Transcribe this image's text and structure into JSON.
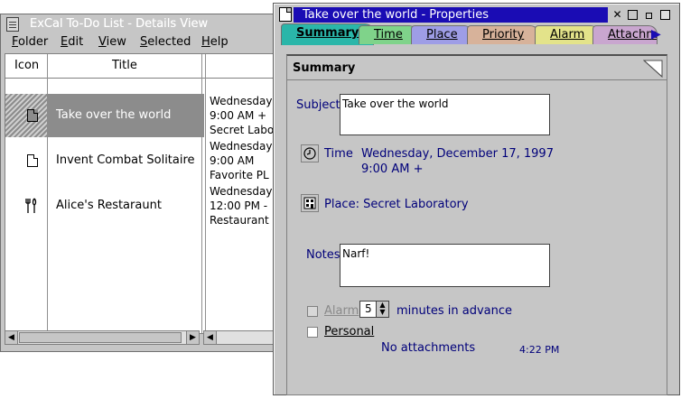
{
  "back_window": {
    "title": "ExCal To-Do List - Details View",
    "menu": [
      "Folder",
      "Edit",
      "View",
      "Selected",
      "Help"
    ],
    "columns": {
      "icon": "Icon",
      "title": "Title"
    },
    "rows": [
      {
        "title": "Take over the world",
        "icon": "document-icon",
        "details": [
          "Wednesday,",
          "9:00 AM +",
          "Secret Labo"
        ]
      },
      {
        "title": "Invent Combat Solitaire",
        "icon": "document-icon",
        "details": [
          "Wednesday,",
          "9:00 AM",
          "Favorite PL"
        ]
      },
      {
        "title": "Alice's Restaraunt",
        "icon": "fork-knife-icon",
        "details": [
          "Wednesday,",
          "12:00 PM -",
          "Restaurant"
        ]
      }
    ]
  },
  "front_window": {
    "title": "Take over the world - Properties",
    "tabs": [
      {
        "label": "Summary",
        "color": "#2ab6a9"
      },
      {
        "label": "Time",
        "color": "#7fd38a"
      },
      {
        "label": "Place",
        "color": "#9e9de6"
      },
      {
        "label": "Priority",
        "color": "#d7b29a"
      },
      {
        "label": "Alarm",
        "color": "#e3e38a"
      },
      {
        "label": "Attachm",
        "color": "#c9a6cf"
      }
    ],
    "page_heading": "Summary",
    "subject_label": "Subject",
    "subject_value": "Take over the world",
    "time_label": "Time",
    "time_value_line1": "Wednesday, December 17, 1997",
    "time_value_line2": "9:00 AM +",
    "place_text": "Place: Secret Laboratory",
    "notes_label": "Notes",
    "notes_value": "Narf!",
    "alarm_label": "Alarm",
    "alarm_value": "5",
    "alarm_suffix": "minutes in advance",
    "personal_label": "Personal",
    "attachments_text": "No attachments",
    "clock": "4:22 PM"
  },
  "colors": {
    "title_active": "#1a0cb4",
    "label_blue": "#00007a",
    "selection": "#8c8c8c"
  }
}
